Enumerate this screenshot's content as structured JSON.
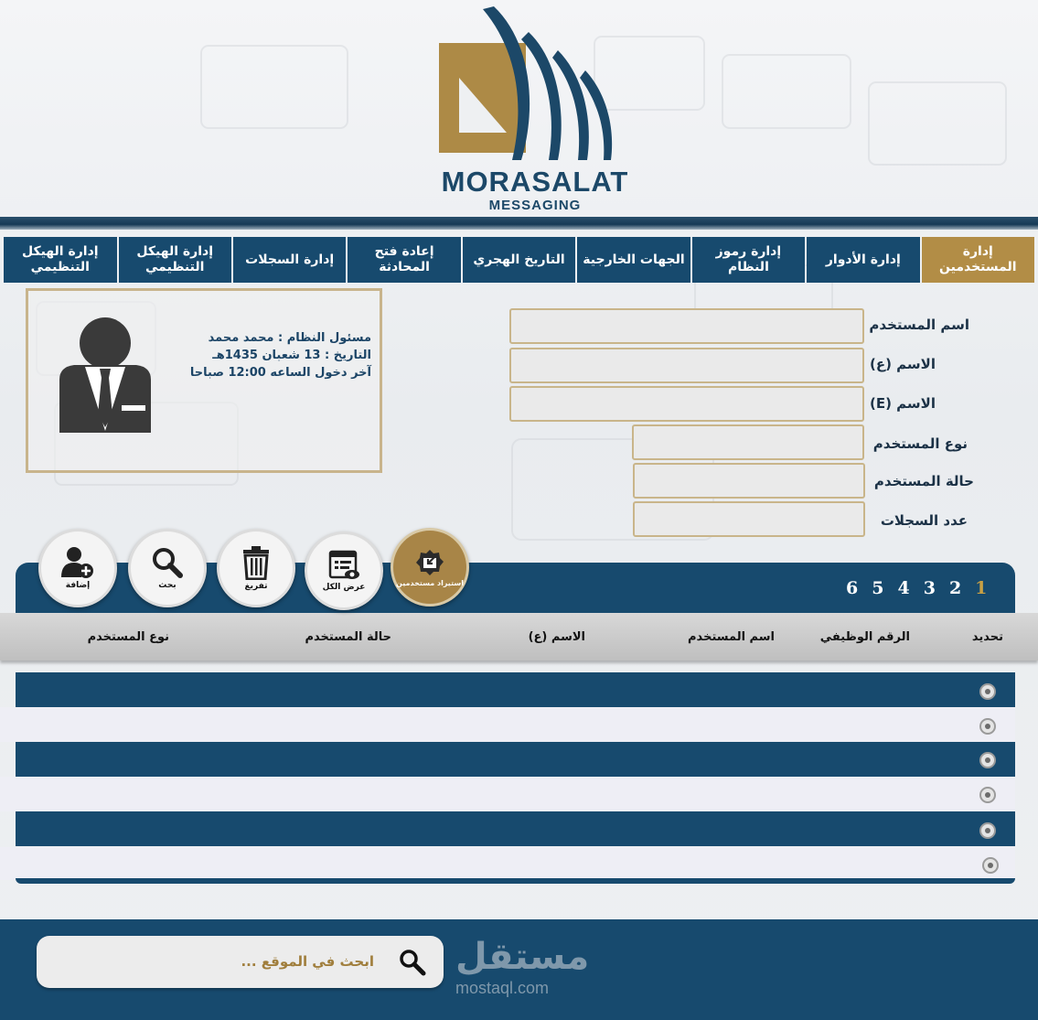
{
  "colors": {
    "navy": "#174a6e",
    "gold": "#b28d46",
    "input_border": "#c9b58a"
  },
  "logo": {
    "title": "MORASALAT",
    "subtitle": "MESSAGING"
  },
  "nav": {
    "tabs": [
      {
        "label": "إدارة المستخدمين",
        "active": true
      },
      {
        "label": "إدارة الأدوار"
      },
      {
        "label": "إدارة رموز النظام"
      },
      {
        "label": "الجهات الخارجية"
      },
      {
        "label": "التاريخ الهجري"
      },
      {
        "label": "إعادة فتح المحادثة"
      },
      {
        "label": "إدارة السجلات"
      },
      {
        "label": "إدارة الهيكل التنظيمي"
      },
      {
        "label": "إدارة الهيكل التنظيمي"
      }
    ]
  },
  "form": {
    "fields": [
      {
        "label": "اسم المستخدم",
        "value": ""
      },
      {
        "label": "الاسم (ع)",
        "value": ""
      },
      {
        "label": "الاسم (E)",
        "value": ""
      },
      {
        "label": "نوع المستخدم",
        "value": ""
      },
      {
        "label": "حالة المستخدم",
        "value": ""
      },
      {
        "label": "عدد السجلات",
        "value": ""
      }
    ]
  },
  "user_card": {
    "line1": "مسئول النظام : محمد محمد",
    "line2": "التاريخ : 13 شعبان 1435هـ",
    "line3": "آخر دخول الساعه 12:00 صباحا",
    "avatar_icon": "user-tie-icon"
  },
  "actions": {
    "import": {
      "label": "استيراد مستخدمين",
      "icon": "import-icon"
    },
    "view_all": {
      "label": "عرض الكل",
      "icon": "list-view-icon"
    },
    "clear": {
      "label": "تفريغ",
      "icon": "trash-icon"
    },
    "search": {
      "label": "بحث",
      "icon": "search-icon"
    },
    "add": {
      "label": "إضافة",
      "icon": "add-user-icon"
    }
  },
  "pager": {
    "pages": [
      "1",
      "2",
      "3",
      "4",
      "5",
      "6"
    ],
    "current": "1"
  },
  "table": {
    "headers": {
      "select": "تحديد",
      "employee_no": "الرقم الوظيفي",
      "username": "اسم المستخدم",
      "name_ar": "الاسم (ع)",
      "status": "حالة المستخدم",
      "type": "نوع المستخدم"
    },
    "row_count": 6
  },
  "footer": {
    "search_placeholder": "ابحث في الموقع ...",
    "brand_ar": "مستقل",
    "brand_en": "mostaql.com"
  }
}
